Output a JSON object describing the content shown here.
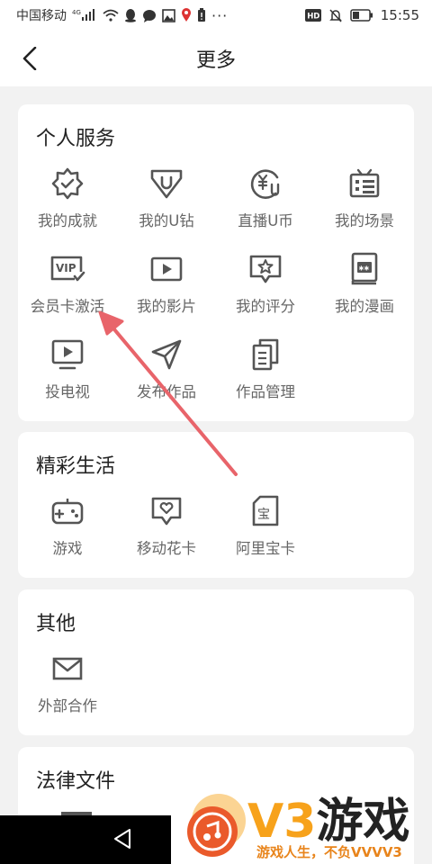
{
  "status_bar": {
    "carrier": "中国移动",
    "network": "4G",
    "battery": "",
    "time": "15:55",
    "hd": "HD"
  },
  "header": {
    "title": "更多"
  },
  "sections": {
    "personal": {
      "title": "个人服务",
      "items": [
        {
          "label": "我的成就",
          "icon": "badge-check-icon"
        },
        {
          "label": "我的U钻",
          "icon": "u-diamond-icon"
        },
        {
          "label": "直播U币",
          "icon": "u-coin-icon"
        },
        {
          "label": "我的场景",
          "icon": "tv-scene-icon"
        },
        {
          "label": "会员卡激活",
          "icon": "vip-card-icon"
        },
        {
          "label": "我的影片",
          "icon": "video-icon"
        },
        {
          "label": "我的评分",
          "icon": "rating-star-icon"
        },
        {
          "label": "我的漫画",
          "icon": "comic-book-icon"
        },
        {
          "label": "投电视",
          "icon": "cast-tv-icon"
        },
        {
          "label": "发布作品",
          "icon": "send-icon"
        },
        {
          "label": "作品管理",
          "icon": "works-manage-icon"
        }
      ]
    },
    "life": {
      "title": "精彩生活",
      "items": [
        {
          "label": "游戏",
          "icon": "gamepad-icon"
        },
        {
          "label": "移动花卡",
          "icon": "flower-card-icon"
        },
        {
          "label": "阿里宝卡",
          "icon": "sim-card-icon"
        }
      ]
    },
    "other": {
      "title": "其他",
      "items": [
        {
          "label": "外部合作",
          "icon": "mail-icon"
        }
      ]
    },
    "legal": {
      "title": "法律文件"
    }
  },
  "watermark": {
    "brand_v3": "V3",
    "brand_game": "游戏",
    "slogan": "游戏人生，不负VVVV3"
  },
  "colors": {
    "accent_arrow": "#e8646a",
    "icon": "#555555",
    "label": "#666666",
    "watermark_orange": "#f7a21b"
  }
}
